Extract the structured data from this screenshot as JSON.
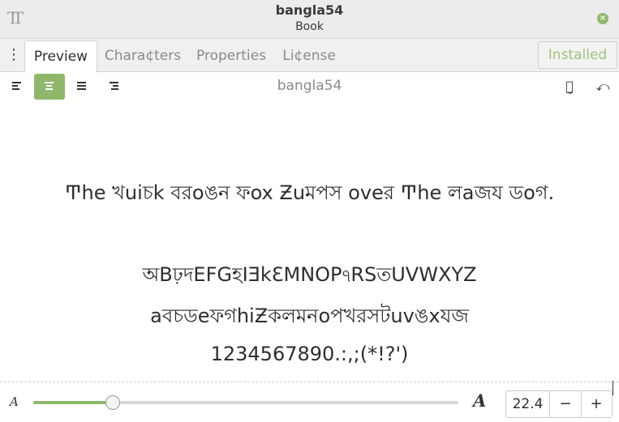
{
  "window": {
    "title": "bangla54",
    "subtitle": "Book",
    "app_icon_text": "TT",
    "close_icon": "close-icon",
    "close_color": "#8fb86b"
  },
  "tabs": {
    "menu_icon": "⋮",
    "items": [
      {
        "label": "Preview",
        "active": true
      },
      {
        "label": "Chara¢ters",
        "active": false
      },
      {
        "label": "Properties",
        "active": false
      },
      {
        "label": "Li¢ense",
        "active": false
      }
    ],
    "installed_label": "Installed"
  },
  "toolbar": {
    "alignments": [
      "align-left",
      "align-center",
      "align-justify",
      "align-right"
    ],
    "active_alignment": "align-center",
    "font_name": "bangla54",
    "compare_icon": "ৱ̬",
    "undo_icon": "⤺",
    "accent": "#8fb86b"
  },
  "preview": {
    "pangram": "Ͳhe খuiচk বরoঙন ফox Ƶuমপস oveর Ͳhe লaজয ডoগ.",
    "uppercase": "অBঢ়দEFGহIƎkƐMNOPঀRSতUVWXYZ",
    "lowercase": "aবচডeফগhiƵকলমনoপখরসটuvঙxযজ",
    "digits": "1234567890.:,;(*!?')"
  },
  "size_control": {
    "small_a": "A",
    "large_a": "A",
    "value": "22.4",
    "minus": "−",
    "plus": "+",
    "slider_fraction": 0.186
  }
}
